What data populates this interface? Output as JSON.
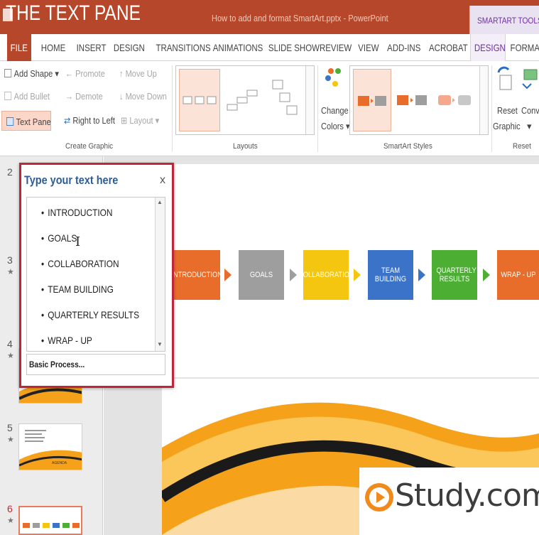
{
  "overlay_title": "THE TEXT PANE",
  "window_title": "How to add and format SmartArt.pptx - PowerPoint",
  "contextual_tab_title": "SMARTART TOOLS",
  "tabs": [
    "FILE",
    "HOME",
    "INSERT",
    "DESIGN",
    "TRANSITIONS",
    "ANIMATIONS",
    "SLIDE SHOW",
    "REVIEW",
    "VIEW",
    "ADD-INS",
    "ACROBAT",
    "DESIGN",
    "FORMA"
  ],
  "ribbon": {
    "create_graphic": {
      "add_shape": "Add Shape",
      "promote": "Promote",
      "move_up": "Move Up",
      "add_bullet": "Add Bullet",
      "demote": "Demote",
      "move_down": "Move Down",
      "text_pane": "Text Pane",
      "right_to_left": "Right to Left",
      "layout": "Layout",
      "label": "Create Graphic"
    },
    "layouts": {
      "label": "Layouts"
    },
    "smartart_styles": {
      "change": "Change",
      "colors": "Colors",
      "label": "SmartArt Styles"
    },
    "reset": {
      "reset": "Reset",
      "graphic": "Graphic",
      "convert": "Conve",
      "label": "Reset"
    }
  },
  "slide_panel": {
    "numbers": [
      "2",
      "3",
      "4",
      "5",
      "6"
    ],
    "thumb_caption": "AGENDA"
  },
  "text_pane": {
    "title": "Type your text here",
    "close": "x",
    "items": [
      "INTRODUCTION",
      "GOALS",
      "COLLABORATION",
      "TEAM BUILDING",
      "QUARTERLY RESULTS",
      "WRAP - UP"
    ],
    "footer": "Basic Process..."
  },
  "smartart": {
    "boxes": [
      {
        "label": "INTRODUCTION",
        "color": "#e86c2a"
      },
      {
        "label": "GOALS",
        "color": "#9e9e9e"
      },
      {
        "label": "COLLABORATION",
        "color": "#f5c60f"
      },
      {
        "label": "TEAM BUILDING",
        "color": "#3a73c8"
      },
      {
        "label": "QUARTERLY RESULTS",
        "color": "#4caf33"
      },
      {
        "label": "WRAP - UP",
        "color": "#e86c2a"
      }
    ]
  },
  "watermark": {
    "text": "Study.com",
    "accent": "#f08a1d"
  },
  "colors": {
    "ppt_red": "#b7472a",
    "smartart_purple": "#7030a0",
    "pane_border": "#c0263a"
  }
}
